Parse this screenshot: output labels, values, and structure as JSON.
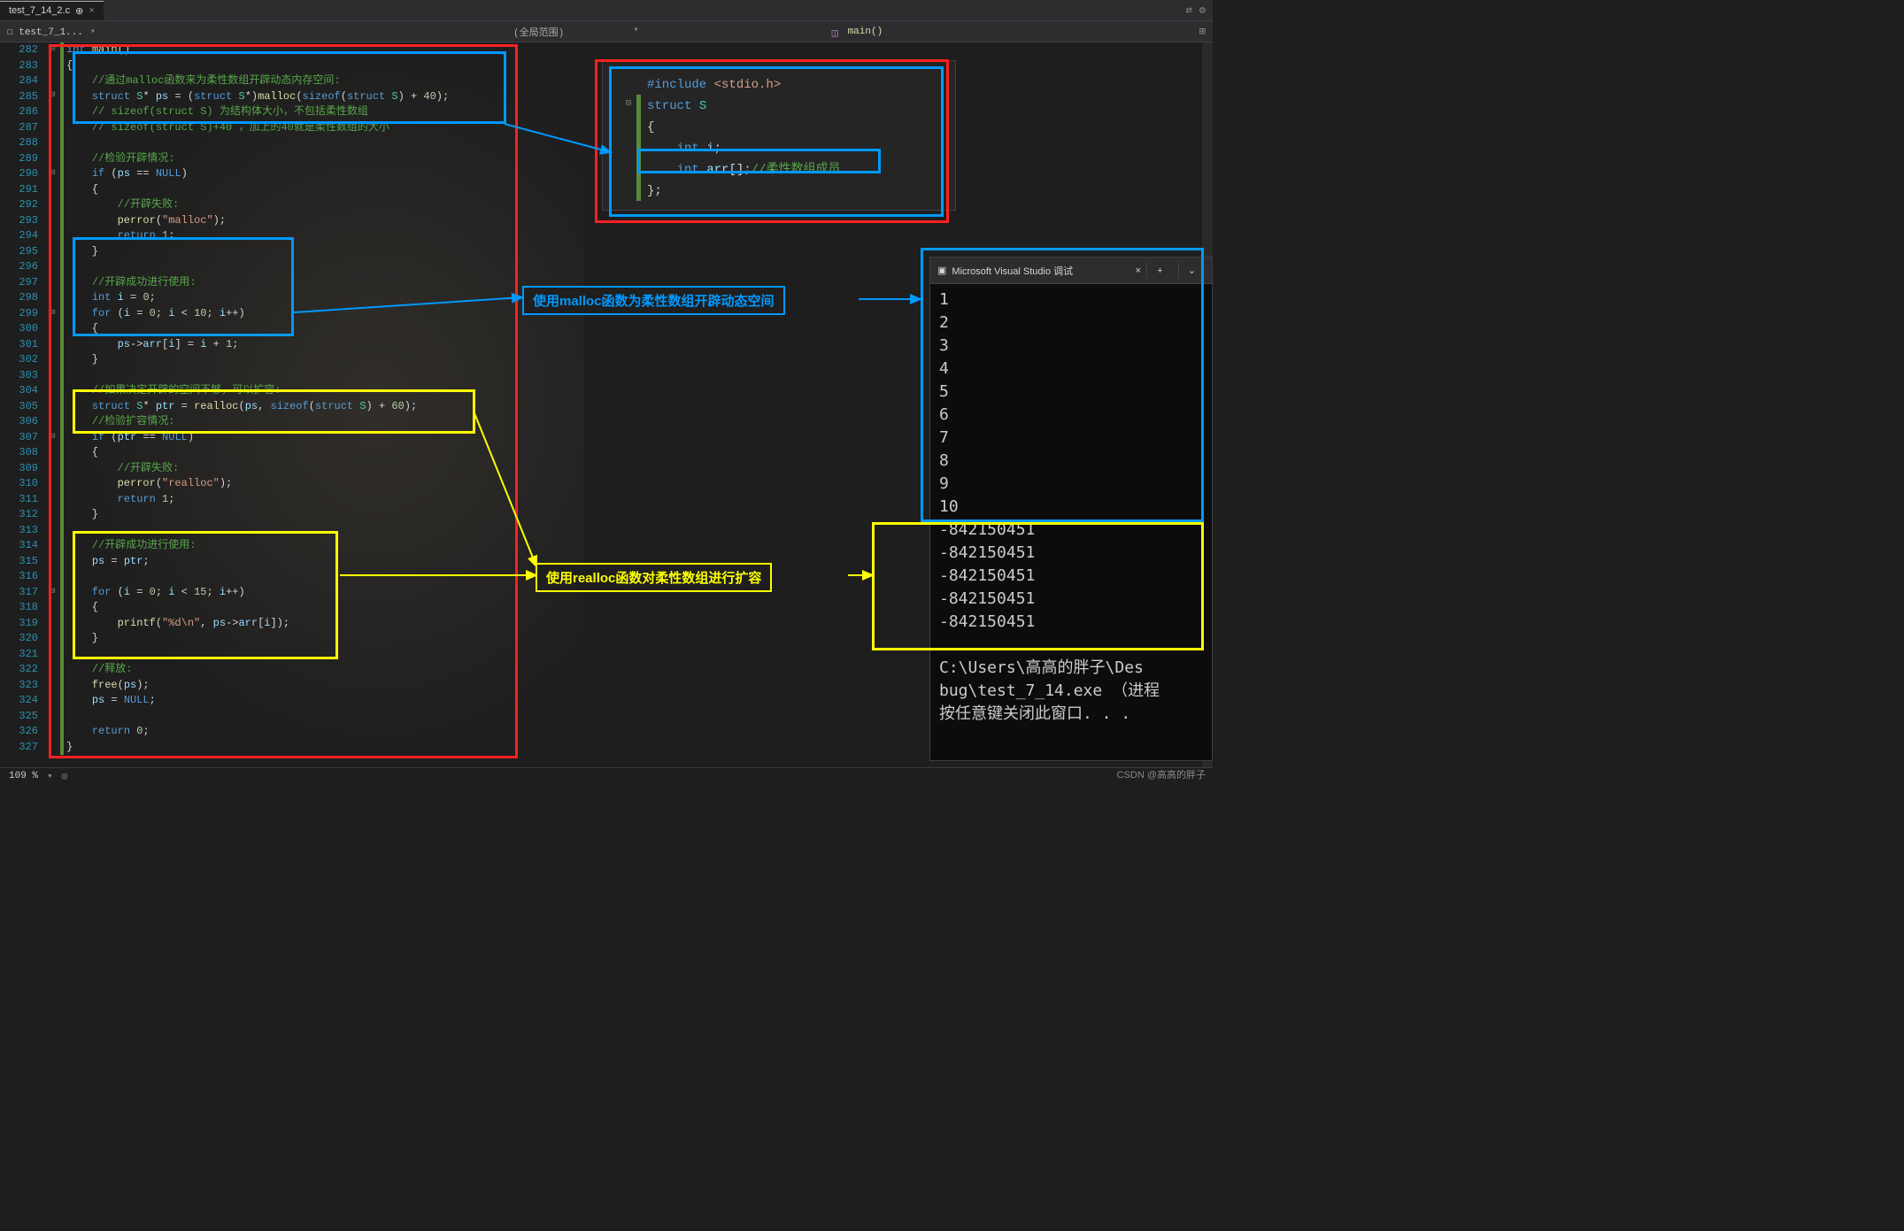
{
  "tab": {
    "name": "test_7_14_2.c",
    "pin": "⊕"
  },
  "titlebar": {
    "expand": "⇄",
    "gear": "⚙"
  },
  "toolbar": {
    "file_indicator": "test_7_1...",
    "scope_label": "(全局范围)",
    "function_name": "main()",
    "dropdown": "▾",
    "split_icon": "⊞"
  },
  "lines": {
    "start": 282,
    "end": 327
  },
  "code": [
    {
      "n": 282,
      "tokens": [
        {
          "c": "kw",
          "t": "int"
        },
        {
          "t": " "
        },
        {
          "c": "fn",
          "t": "main"
        },
        {
          "t": "()"
        }
      ]
    },
    {
      "n": 283,
      "tokens": [
        {
          "t": "{"
        }
      ]
    },
    {
      "n": 284,
      "tokens": [
        {
          "t": "    "
        },
        {
          "c": "cmt",
          "t": "//通过malloc函数来为柔性数组开辟动态内存空间:"
        }
      ]
    },
    {
      "n": 285,
      "tokens": [
        {
          "t": "    "
        },
        {
          "c": "kw",
          "t": "struct"
        },
        {
          "t": " "
        },
        {
          "c": "type",
          "t": "S"
        },
        {
          "t": "* "
        },
        {
          "c": "var",
          "t": "ps"
        },
        {
          "t": " = ("
        },
        {
          "c": "kw",
          "t": "struct"
        },
        {
          "t": " "
        },
        {
          "c": "type",
          "t": "S"
        },
        {
          "t": "*)"
        },
        {
          "c": "fn",
          "t": "malloc"
        },
        {
          "t": "("
        },
        {
          "c": "kw",
          "t": "sizeof"
        },
        {
          "t": "("
        },
        {
          "c": "kw",
          "t": "struct"
        },
        {
          "t": " "
        },
        {
          "c": "type",
          "t": "S"
        },
        {
          "t": ") + "
        },
        {
          "c": "num",
          "t": "40"
        },
        {
          "t": ");"
        }
      ]
    },
    {
      "n": 286,
      "tokens": [
        {
          "t": "    "
        },
        {
          "c": "cmt",
          "t": "// sizeof(struct S) 为结构体大小，不包括柔性数组"
        }
      ]
    },
    {
      "n": 287,
      "tokens": [
        {
          "t": "    "
        },
        {
          "c": "cmt",
          "t": "// sizeof(struct S)+40 ，加上的40就是柔性数组的大小"
        }
      ]
    },
    {
      "n": 288,
      "tokens": []
    },
    {
      "n": 289,
      "tokens": [
        {
          "t": "    "
        },
        {
          "c": "cmt",
          "t": "//检验开辟情况:"
        }
      ]
    },
    {
      "n": 290,
      "tokens": [
        {
          "t": "    "
        },
        {
          "c": "kw",
          "t": "if"
        },
        {
          "t": " ("
        },
        {
          "c": "var",
          "t": "ps"
        },
        {
          "t": " == "
        },
        {
          "c": "kw",
          "t": "NULL"
        },
        {
          "t": ")"
        }
      ]
    },
    {
      "n": 291,
      "tokens": [
        {
          "t": "    {"
        }
      ]
    },
    {
      "n": 292,
      "tokens": [
        {
          "t": "        "
        },
        {
          "c": "cmt",
          "t": "//开辟失败:"
        }
      ]
    },
    {
      "n": 293,
      "tokens": [
        {
          "t": "        "
        },
        {
          "c": "fn",
          "t": "perror"
        },
        {
          "t": "("
        },
        {
          "c": "str",
          "t": "\"malloc\""
        },
        {
          "t": ");"
        }
      ]
    },
    {
      "n": 294,
      "tokens": [
        {
          "t": "        "
        },
        {
          "c": "kw",
          "t": "return"
        },
        {
          "t": " "
        },
        {
          "c": "num",
          "t": "1"
        },
        {
          "t": ";"
        }
      ]
    },
    {
      "n": 295,
      "tokens": [
        {
          "t": "    }"
        }
      ]
    },
    {
      "n": 296,
      "tokens": []
    },
    {
      "n": 297,
      "tokens": [
        {
          "t": "    "
        },
        {
          "c": "cmt",
          "t": "//开辟成功进行使用:"
        }
      ]
    },
    {
      "n": 298,
      "tokens": [
        {
          "t": "    "
        },
        {
          "c": "kw",
          "t": "int"
        },
        {
          "t": " "
        },
        {
          "c": "var",
          "t": "i"
        },
        {
          "t": " = "
        },
        {
          "c": "num",
          "t": "0"
        },
        {
          "t": ";"
        }
      ]
    },
    {
      "n": 299,
      "tokens": [
        {
          "t": "    "
        },
        {
          "c": "kw",
          "t": "for"
        },
        {
          "t": " ("
        },
        {
          "c": "var",
          "t": "i"
        },
        {
          "t": " = "
        },
        {
          "c": "num",
          "t": "0"
        },
        {
          "t": "; "
        },
        {
          "c": "var",
          "t": "i"
        },
        {
          "t": " < "
        },
        {
          "c": "num",
          "t": "10"
        },
        {
          "t": "; "
        },
        {
          "c": "var",
          "t": "i"
        },
        {
          "t": "++)"
        }
      ]
    },
    {
      "n": 300,
      "tokens": [
        {
          "t": "    {"
        }
      ]
    },
    {
      "n": 301,
      "tokens": [
        {
          "t": "        "
        },
        {
          "c": "var",
          "t": "ps"
        },
        {
          "t": "->"
        },
        {
          "c": "var",
          "t": "arr"
        },
        {
          "t": "["
        },
        {
          "c": "var",
          "t": "i"
        },
        {
          "t": "] = "
        },
        {
          "c": "var",
          "t": "i"
        },
        {
          "t": " + "
        },
        {
          "c": "num",
          "t": "1"
        },
        {
          "t": ";"
        }
      ]
    },
    {
      "n": 302,
      "tokens": [
        {
          "t": "    }"
        }
      ]
    },
    {
      "n": 303,
      "tokens": []
    },
    {
      "n": 304,
      "tokens": [
        {
          "t": "    "
        },
        {
          "c": "cmt",
          "t": "//如果决定开辟的空间不够，可以扩容:"
        }
      ]
    },
    {
      "n": 305,
      "tokens": [
        {
          "t": "    "
        },
        {
          "c": "kw",
          "t": "struct"
        },
        {
          "t": " "
        },
        {
          "c": "type",
          "t": "S"
        },
        {
          "t": "* "
        },
        {
          "c": "var",
          "t": "ptr"
        },
        {
          "t": " = "
        },
        {
          "c": "fn",
          "t": "realloc"
        },
        {
          "t": "("
        },
        {
          "c": "var",
          "t": "ps"
        },
        {
          "t": ", "
        },
        {
          "c": "kw",
          "t": "sizeof"
        },
        {
          "t": "("
        },
        {
          "c": "kw",
          "t": "struct"
        },
        {
          "t": " "
        },
        {
          "c": "type",
          "t": "S"
        },
        {
          "t": ") + "
        },
        {
          "c": "num",
          "t": "60"
        },
        {
          "t": ");"
        }
      ]
    },
    {
      "n": 306,
      "tokens": [
        {
          "t": "    "
        },
        {
          "c": "cmt",
          "t": "//检验扩容情况:"
        }
      ]
    },
    {
      "n": 307,
      "tokens": [
        {
          "t": "    "
        },
        {
          "c": "kw",
          "t": "if"
        },
        {
          "t": " ("
        },
        {
          "c": "var",
          "t": "ptr"
        },
        {
          "t": " == "
        },
        {
          "c": "kw",
          "t": "NULL"
        },
        {
          "t": ")"
        }
      ]
    },
    {
      "n": 308,
      "tokens": [
        {
          "t": "    {"
        }
      ]
    },
    {
      "n": 309,
      "tokens": [
        {
          "t": "        "
        },
        {
          "c": "cmt",
          "t": "//开辟失败:"
        }
      ]
    },
    {
      "n": 310,
      "tokens": [
        {
          "t": "        "
        },
        {
          "c": "fn",
          "t": "perror"
        },
        {
          "t": "("
        },
        {
          "c": "str",
          "t": "\"realloc\""
        },
        {
          "t": ");"
        }
      ]
    },
    {
      "n": 311,
      "tokens": [
        {
          "t": "        "
        },
        {
          "c": "kw",
          "t": "return"
        },
        {
          "t": " "
        },
        {
          "c": "num",
          "t": "1"
        },
        {
          "t": ";"
        }
      ]
    },
    {
      "n": 312,
      "tokens": [
        {
          "t": "    }"
        }
      ]
    },
    {
      "n": 313,
      "tokens": []
    },
    {
      "n": 314,
      "tokens": [
        {
          "t": "    "
        },
        {
          "c": "cmt",
          "t": "//开辟成功进行使用:"
        }
      ]
    },
    {
      "n": 315,
      "tokens": [
        {
          "t": "    "
        },
        {
          "c": "var",
          "t": "ps"
        },
        {
          "t": " = "
        },
        {
          "c": "var",
          "t": "ptr"
        },
        {
          "t": ";"
        }
      ]
    },
    {
      "n": 316,
      "tokens": []
    },
    {
      "n": 317,
      "tokens": [
        {
          "t": "    "
        },
        {
          "c": "kw",
          "t": "for"
        },
        {
          "t": " ("
        },
        {
          "c": "var",
          "t": "i"
        },
        {
          "t": " = "
        },
        {
          "c": "num",
          "t": "0"
        },
        {
          "t": "; "
        },
        {
          "c": "var",
          "t": "i"
        },
        {
          "t": " < "
        },
        {
          "c": "num",
          "t": "15"
        },
        {
          "t": "; "
        },
        {
          "c": "var",
          "t": "i"
        },
        {
          "t": "++)"
        }
      ]
    },
    {
      "n": 318,
      "tokens": [
        {
          "t": "    {"
        }
      ]
    },
    {
      "n": 319,
      "tokens": [
        {
          "t": "        "
        },
        {
          "c": "fn",
          "t": "printf"
        },
        {
          "t": "("
        },
        {
          "c": "str",
          "t": "\"%d\\n\""
        },
        {
          "t": ", "
        },
        {
          "c": "var",
          "t": "ps"
        },
        {
          "t": "->"
        },
        {
          "c": "var",
          "t": "arr"
        },
        {
          "t": "["
        },
        {
          "c": "var",
          "t": "i"
        },
        {
          "t": "]);"
        }
      ]
    },
    {
      "n": 320,
      "tokens": [
        {
          "t": "    }"
        }
      ]
    },
    {
      "n": 321,
      "tokens": []
    },
    {
      "n": 322,
      "tokens": [
        {
          "t": "    "
        },
        {
          "c": "cmt",
          "t": "//释放:"
        }
      ]
    },
    {
      "n": 323,
      "tokens": [
        {
          "t": "    "
        },
        {
          "c": "fn",
          "t": "free"
        },
        {
          "t": "("
        },
        {
          "c": "var",
          "t": "ps"
        },
        {
          "t": ");"
        }
      ]
    },
    {
      "n": 324,
      "tokens": [
        {
          "t": "    "
        },
        {
          "c": "var",
          "t": "ps"
        },
        {
          "t": " = "
        },
        {
          "c": "kw",
          "t": "NULL"
        },
        {
          "t": ";"
        }
      ]
    },
    {
      "n": 325,
      "tokens": []
    },
    {
      "n": 326,
      "tokens": [
        {
          "t": "    "
        },
        {
          "c": "kw",
          "t": "return"
        },
        {
          "t": " "
        },
        {
          "c": "num",
          "t": "0"
        },
        {
          "t": ";"
        }
      ]
    },
    {
      "n": 327,
      "tokens": [
        {
          "t": "}"
        }
      ]
    }
  ],
  "struct_code": [
    [
      {
        "c": "kw",
        "t": "#include"
      },
      {
        "t": " "
      },
      {
        "c": "str",
        "t": "<stdio.h>"
      }
    ],
    [
      {
        "c": "kw",
        "t": "struct"
      },
      {
        "t": " "
      },
      {
        "c": "type",
        "t": "S"
      }
    ],
    [
      {
        "t": "{"
      }
    ],
    [
      {
        "t": "    "
      },
      {
        "c": "kw",
        "t": "int"
      },
      {
        "t": " "
      },
      {
        "c": "var",
        "t": "i"
      },
      {
        "t": ";"
      }
    ],
    [
      {
        "t": "    "
      },
      {
        "c": "kw",
        "t": "int"
      },
      {
        "t": " "
      },
      {
        "c": "var",
        "t": "arr"
      },
      {
        "t": "[];"
      },
      {
        "c": "cmt",
        "t": "//柔性数组成员"
      }
    ],
    [
      {
        "t": "};"
      }
    ]
  ],
  "annotations": {
    "blue1": "使用malloc函数为柔性数组开辟动态空间",
    "yellow1": "使用realloc函数对柔性数组进行扩容"
  },
  "console": {
    "title": "Microsoft Visual Studio 调试",
    "close": "×",
    "plus": "+",
    "chev": "⌄",
    "output": [
      "1",
      "2",
      "3",
      "4",
      "5",
      "6",
      "7",
      "8",
      "9",
      "10",
      "-842150451",
      "-842150451",
      "-842150451",
      "-842150451",
      "-842150451",
      "",
      "C:\\Users\\高高的胖子\\Des",
      "bug\\test_7_14.exe （进程",
      "按任意键关闭此窗口. . ."
    ]
  },
  "status": {
    "zoom": "109 %"
  },
  "watermark": "CSDN @高高的胖子"
}
